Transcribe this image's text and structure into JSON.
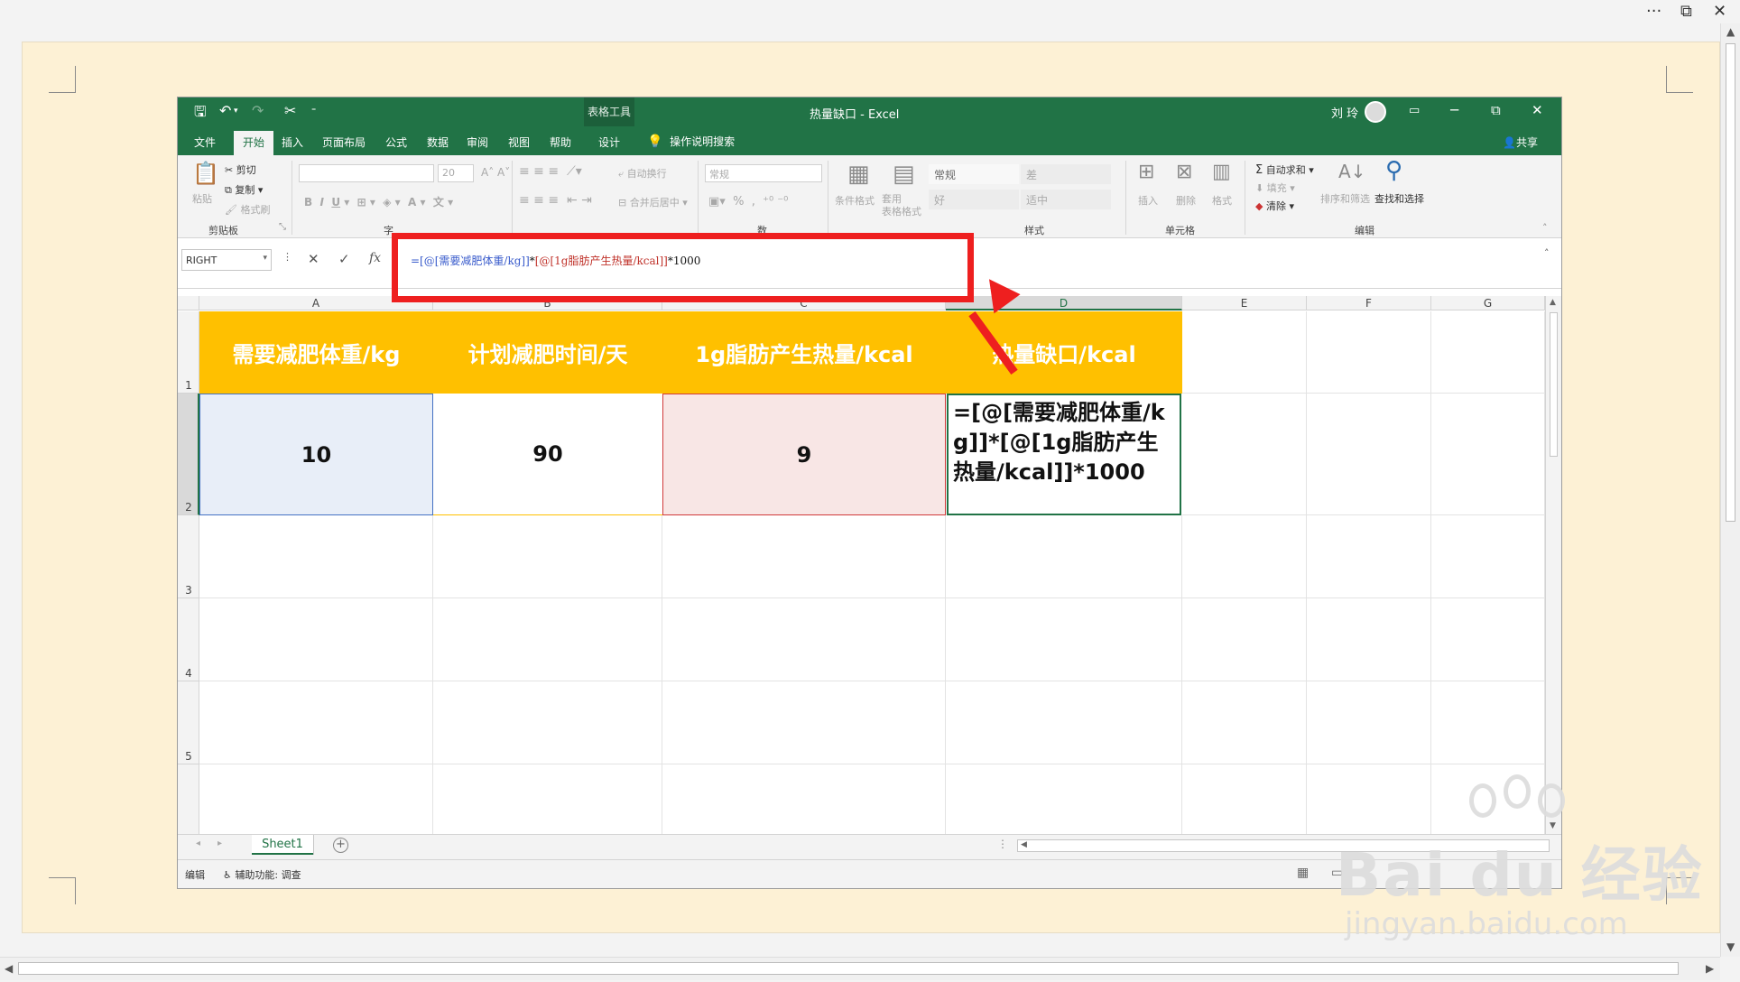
{
  "viewer": {
    "more_label": "···",
    "restore_label": "⧉",
    "close_label": "✕"
  },
  "titlebar": {
    "context_tab": "表格工具",
    "doc_title": "热量缺口 - Excel",
    "user_name": "刘 玲",
    "minimize": "─",
    "restore": "⧉",
    "close": "✕"
  },
  "tabs": {
    "file": "文件",
    "home": "开始",
    "insert": "插入",
    "page_layout": "页面布局",
    "formulas": "公式",
    "data": "数据",
    "review": "审阅",
    "view": "视图",
    "help": "帮助",
    "design": "设计",
    "tell_me": "操作说明搜索",
    "share": "共享"
  },
  "ribbon": {
    "paste": "粘贴",
    "cut": "剪切",
    "copy": "复制",
    "format_painter": "格式刷",
    "clipboard": "剪贴板",
    "font_size": "20",
    "wrap_text": "自动换行",
    "merge_center": "合并后居中",
    "number_format": "常规",
    "conditional_format": "条件格式",
    "format_as_table": "套用\n表格格式",
    "style_normal": "常规",
    "style_bad": "差",
    "style_good": "好",
    "style_neutral": "适中",
    "styles": "样式",
    "insert": "插入",
    "delete": "删除",
    "format": "格式",
    "cells": "单元格",
    "autosum": "自动求和",
    "fill": "填充",
    "clear": "清除",
    "sort_filter": "排序和筛选",
    "find_select": "查找和选择",
    "editing": "编辑",
    "font_group_partial": "字",
    "number_group_partial": "数"
  },
  "formula_bar": {
    "name_box": "RIGHT",
    "fx": "fx",
    "part1": "=[@[需要减肥体重/kg]]",
    "part2": "*",
    "part3": "[@[1g脂肪产生热量/kcal]]",
    "part4": "*1000"
  },
  "sheet": {
    "columns": [
      "A",
      "B",
      "C",
      "D",
      "E",
      "F",
      "G"
    ],
    "rows": [
      "1",
      "2",
      "3",
      "4",
      "5"
    ],
    "headers": [
      "需要减肥体重/kg",
      "计划减肥时间/天",
      "1g脂肪产生热量/kcal",
      "热量缺口/kcal"
    ],
    "values": [
      "10",
      "90",
      "9"
    ],
    "editing_formula": "=[@[需要减肥体重/kg]]*[@[1g脂肪产生热量/kcal]]*1000",
    "tab_name": "Sheet1"
  },
  "status": {
    "mode": "编辑",
    "accessibility": "辅助功能: 调查"
  },
  "watermark": {
    "brand": "Bai du 经验",
    "url": "jingyan.baidu.com"
  },
  "colors": {
    "excel_green": "#217346",
    "header_fill": "#ffc000",
    "annotation_red": "#ee1f1f"
  }
}
